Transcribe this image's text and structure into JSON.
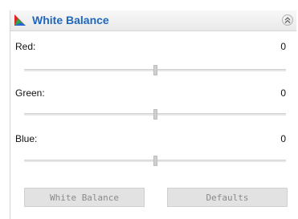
{
  "panel": {
    "title": "White Balance",
    "collapse_icon": "double-chevron-up-icon",
    "header_icon": "color-triangle-icon"
  },
  "sliders": [
    {
      "label": "Red:",
      "value": "0",
      "level": 0.5
    },
    {
      "label": "Green:",
      "value": "0",
      "level": 0.5
    },
    {
      "label": "Blue:",
      "value": "0",
      "level": 0.5
    }
  ],
  "buttons": {
    "white_balance_label": "White Balance",
    "defaults_label": "Defaults"
  },
  "colors": {
    "title": "#1f66bf",
    "disabled_text": "#8a8a8a"
  }
}
